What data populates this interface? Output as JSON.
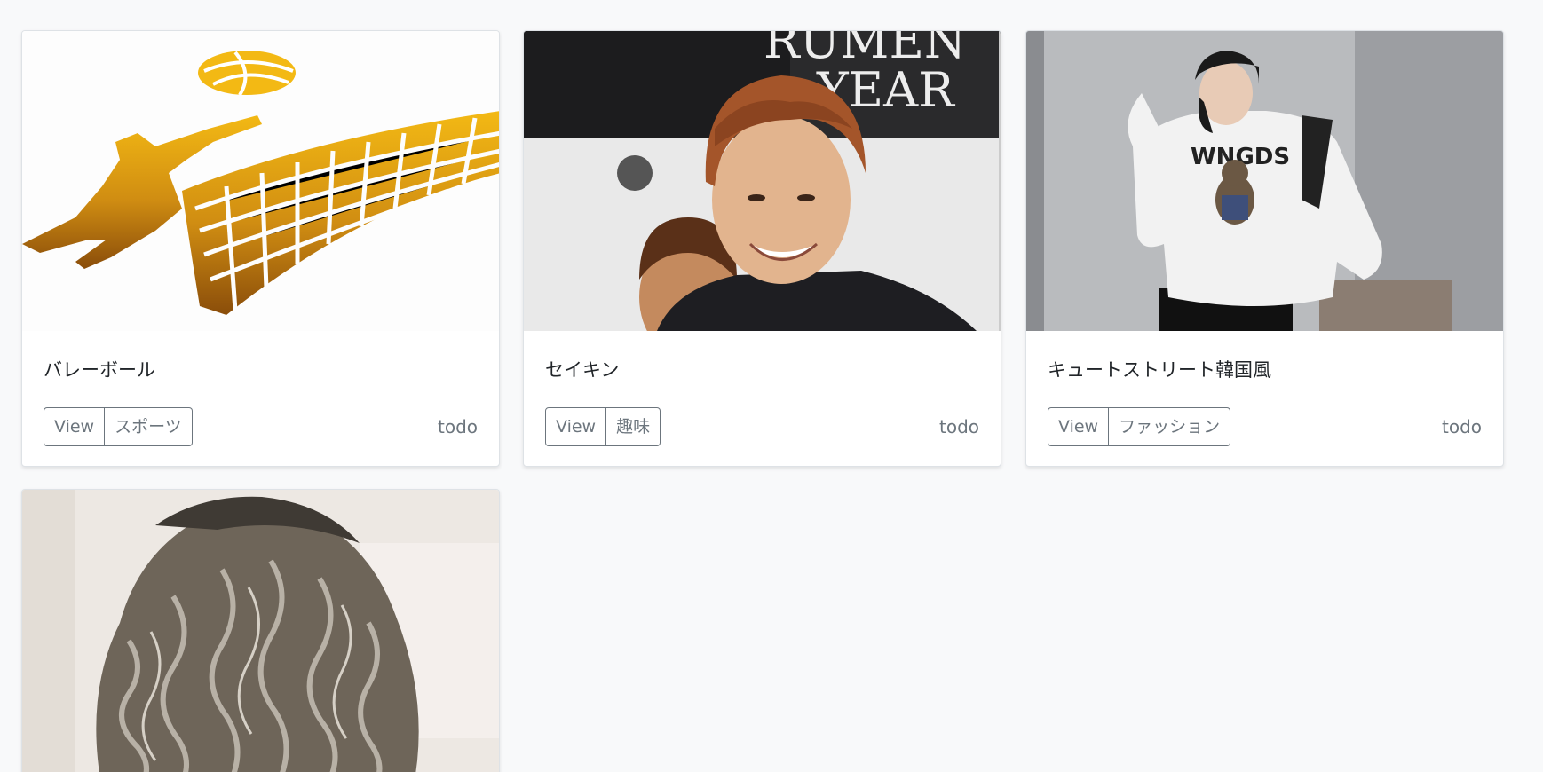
{
  "cards": [
    {
      "title": "バレーボール",
      "view_label": "View",
      "tag_label": "スポーツ",
      "status": "todo"
    },
    {
      "title": "セイキン",
      "view_label": "View",
      "tag_label": "趣味",
      "status": "todo"
    },
    {
      "title": "キュートストリート韓国風",
      "view_label": "View",
      "tag_label": "ファッション",
      "status": "todo"
    },
    {
      "title": "",
      "view_label": "",
      "tag_label": "",
      "status": ""
    }
  ],
  "colors": {
    "page_background": "#f8f9fa",
    "card_background": "#ffffff",
    "button_outline": "#6c757d",
    "title_text": "#212529"
  }
}
